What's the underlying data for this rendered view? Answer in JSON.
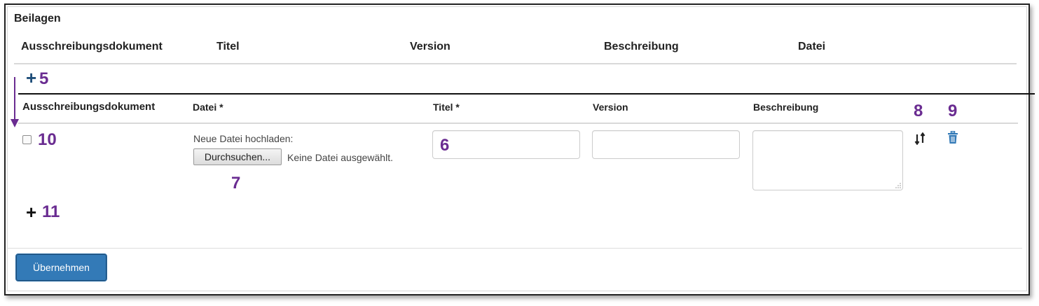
{
  "section_title": "Beilagen",
  "table_headers": [
    "Ausschreibungsdokument",
    "Titel",
    "Version",
    "Beschreibung",
    "Datei"
  ],
  "add_row_symbol": "+",
  "annotations": {
    "n5": "5",
    "n6": "6",
    "n7": "7",
    "n8": "8",
    "n9": "9",
    "n10": "10",
    "n11": "11"
  },
  "edit_headers": {
    "ausschreibungsdokument": "Ausschreibungsdokument",
    "datei": "Datei *",
    "titel": "Titel *",
    "version": "Version",
    "beschreibung": "Beschreibung"
  },
  "row": {
    "checkbox_checked": false,
    "upload_label": "Neue Datei hochladen:",
    "browse_button": "Durchsuchen...",
    "no_file_text": "Keine Datei ausgewählt.",
    "title_value": "",
    "version_value": "",
    "description_value": ""
  },
  "icons": {
    "sort": "sort-icon",
    "delete": "trash-icon",
    "add": "plus-icon"
  },
  "submit_button": "Übernehmen",
  "colors": {
    "primary": "#337ab7",
    "annotation": "#6a2c91",
    "plus_blue": "#1f4e79",
    "delete_icon": "#337ab7"
  }
}
